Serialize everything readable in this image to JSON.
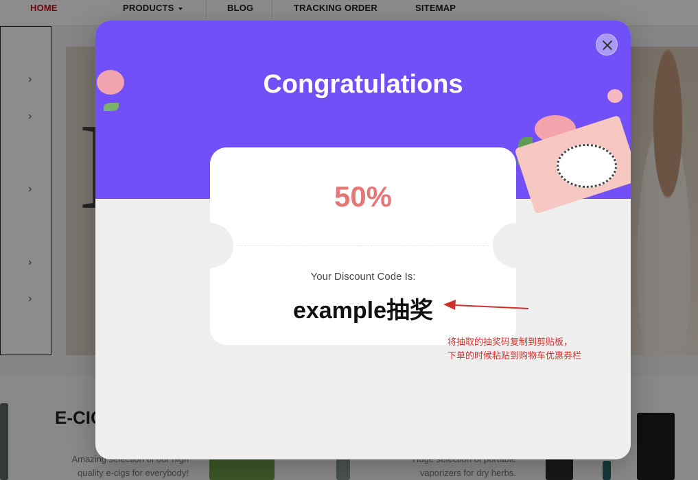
{
  "nav": {
    "items": [
      {
        "label": "HOME",
        "active": true
      },
      {
        "label": "PRODUCTS",
        "has_dropdown": true
      },
      {
        "label": "BLOG"
      },
      {
        "label": "TRACKING ORDER"
      },
      {
        "label": "SITEMAP"
      }
    ]
  },
  "section": {
    "title": "E-CIG",
    "left_desc": [
      "Amazing selection of our high",
      "quality e-cigs for everybody!"
    ],
    "right_desc": [
      "Huge selection of portable",
      "vaporizers for dry herbs."
    ]
  },
  "modal": {
    "title": "Congratulations",
    "discount": "50%",
    "code_label": "Your Discount Code Is:",
    "code_value": "example抽奖",
    "close_icon": "close-icon",
    "colors": {
      "header": "#7150f7",
      "discount": "#e47777",
      "body": "#efefef"
    }
  },
  "annotation": {
    "line1": "将抽取的抽奖码复制到剪贴板，",
    "line2": "下单的时候粘贴到购物车优惠券栏",
    "color": "#d0302b"
  }
}
